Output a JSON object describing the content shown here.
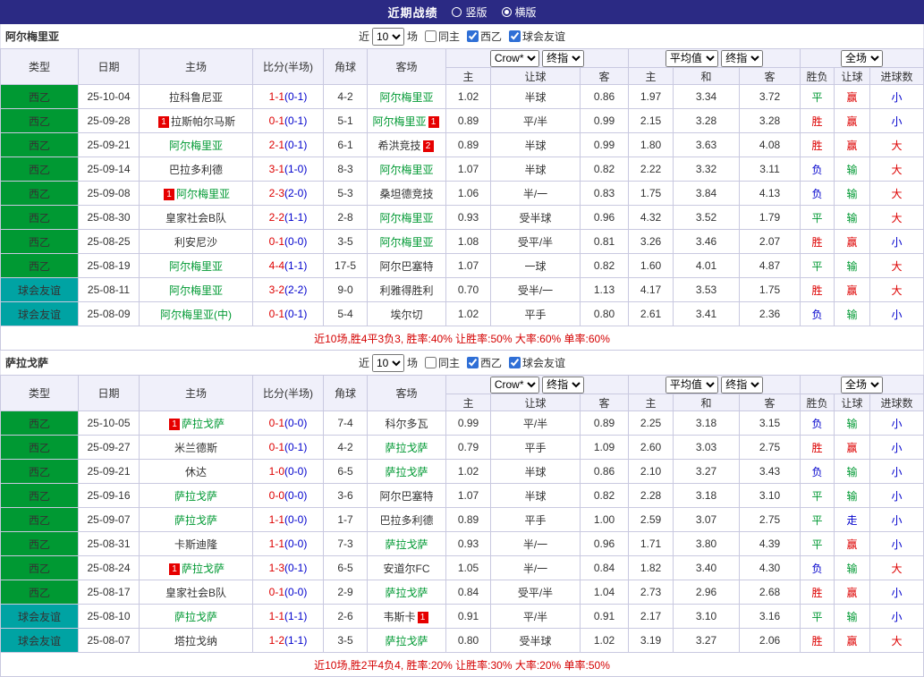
{
  "colors": {
    "red": "#dd0000",
    "green": "#009933",
    "blue": "#0000cc",
    "teal": "#00a3a3",
    "focus_team": "#009933",
    "score": "#dd0000",
    "half": "#0000cc",
    "topbar_bg": "#2b2a84",
    "summary": "#d40000"
  },
  "top_bar": {
    "title": "近期战绩",
    "vertical": "竖版",
    "horizontal": "横版"
  },
  "filter": {
    "near_label": "近",
    "count": "10",
    "games_label": "场",
    "same_home": "同主",
    "league": "西乙",
    "friendly": "球会友谊"
  },
  "table_head": {
    "type": "类型",
    "date": "日期",
    "home": "主场",
    "score": "比分(半场)",
    "corner": "角球",
    "away": "客场",
    "bookmaker": "Crow*",
    "final_odds": "终指",
    "average": "平均值",
    "full_match": "全场",
    "odds_home": "主",
    "odds_handicap": "让球",
    "odds_away": "客",
    "avg_home": "主",
    "avg_draw": "和",
    "avg_away": "客",
    "wdl": "胜负",
    "handicap_result": "让球",
    "goals": "进球数"
  },
  "sections": [
    {
      "team": "阿尔梅里亚",
      "summary": "近10场,胜4平3负3, 胜率:40% 让胜率:50% 大率:60% 单率:60%",
      "rows": [
        {
          "league": "西乙",
          "lc": "green",
          "date": "25-10-04",
          "home": {
            "name": "拉科鲁尼亚",
            "focus": false
          },
          "score": "1-1",
          "half": "(0-1)",
          "corners": "4-2",
          "away": {
            "name": "阿尔梅里亚",
            "focus": true
          },
          "odds": [
            "1.02",
            "半球",
            "0.86"
          ],
          "avg": [
            "1.97",
            "3.34",
            "3.72"
          ],
          "res": [
            [
              "平",
              "green"
            ],
            [
              "赢",
              "red"
            ],
            [
              "小",
              "blue"
            ]
          ]
        },
        {
          "league": "西乙",
          "lc": "green",
          "date": "25-09-28",
          "home": {
            "name": "拉斯帕尔马斯",
            "focus": false,
            "card": {
              "n": "1",
              "pos": "before"
            }
          },
          "score": "0-1",
          "half": "(0-1)",
          "corners": "5-1",
          "away": {
            "name": "阿尔梅里亚",
            "focus": true,
            "card": {
              "n": "1",
              "pos": "after"
            }
          },
          "odds": [
            "0.89",
            "平/半",
            "0.99"
          ],
          "avg": [
            "2.15",
            "3.28",
            "3.28"
          ],
          "res": [
            [
              "胜",
              "red"
            ],
            [
              "赢",
              "red"
            ],
            [
              "小",
              "blue"
            ]
          ]
        },
        {
          "league": "西乙",
          "lc": "green",
          "date": "25-09-21",
          "home": {
            "name": "阿尔梅里亚",
            "focus": true
          },
          "score": "2-1",
          "half": "(0-1)",
          "corners": "6-1",
          "away": {
            "name": "希洪竞技",
            "focus": false,
            "card": {
              "n": "2",
              "pos": "after"
            }
          },
          "odds": [
            "0.89",
            "半球",
            "0.99"
          ],
          "avg": [
            "1.80",
            "3.63",
            "4.08"
          ],
          "res": [
            [
              "胜",
              "red"
            ],
            [
              "赢",
              "red"
            ],
            [
              "大",
              "red"
            ]
          ]
        },
        {
          "league": "西乙",
          "lc": "green",
          "date": "25-09-14",
          "home": {
            "name": "巴拉多利德",
            "focus": false
          },
          "score": "3-1",
          "half": "(1-0)",
          "corners": "8-3",
          "away": {
            "name": "阿尔梅里亚",
            "focus": true
          },
          "odds": [
            "1.07",
            "半球",
            "0.82"
          ],
          "avg": [
            "2.22",
            "3.32",
            "3.11"
          ],
          "res": [
            [
              "负",
              "blue"
            ],
            [
              "输",
              "green"
            ],
            [
              "大",
              "red"
            ]
          ]
        },
        {
          "league": "西乙",
          "lc": "green",
          "date": "25-09-08",
          "home": {
            "name": "阿尔梅里亚",
            "focus": true,
            "card": {
              "n": "1",
              "pos": "before"
            }
          },
          "score": "2-3",
          "half": "(2-0)",
          "corners": "5-3",
          "away": {
            "name": "桑坦德竞技",
            "focus": false
          },
          "odds": [
            "1.06",
            "半/一",
            "0.83"
          ],
          "avg": [
            "1.75",
            "3.84",
            "4.13"
          ],
          "res": [
            [
              "负",
              "blue"
            ],
            [
              "输",
              "green"
            ],
            [
              "大",
              "red"
            ]
          ]
        },
        {
          "league": "西乙",
          "lc": "green",
          "date": "25-08-30",
          "home": {
            "name": "皇家社会B队",
            "focus": false
          },
          "score": "2-2",
          "half": "(1-1)",
          "corners": "2-8",
          "away": {
            "name": "阿尔梅里亚",
            "focus": true
          },
          "odds": [
            "0.93",
            "受半球",
            "0.96"
          ],
          "avg": [
            "4.32",
            "3.52",
            "1.79"
          ],
          "res": [
            [
              "平",
              "green"
            ],
            [
              "输",
              "green"
            ],
            [
              "大",
              "red"
            ]
          ]
        },
        {
          "league": "西乙",
          "lc": "green",
          "date": "25-08-25",
          "home": {
            "name": "利安尼沙",
            "focus": false
          },
          "score": "0-1",
          "half": "(0-0)",
          "corners": "3-5",
          "away": {
            "name": "阿尔梅里亚",
            "focus": true
          },
          "odds": [
            "1.08",
            "受平/半",
            "0.81"
          ],
          "avg": [
            "3.26",
            "3.46",
            "2.07"
          ],
          "res": [
            [
              "胜",
              "red"
            ],
            [
              "赢",
              "red"
            ],
            [
              "小",
              "blue"
            ]
          ]
        },
        {
          "league": "西乙",
          "lc": "green",
          "date": "25-08-19",
          "home": {
            "name": "阿尔梅里亚",
            "focus": true
          },
          "score": "4-4",
          "half": "(1-1)",
          "corners": "17-5",
          "away": {
            "name": "阿尔巴塞特",
            "focus": false
          },
          "odds": [
            "1.07",
            "一球",
            "0.82"
          ],
          "avg": [
            "1.60",
            "4.01",
            "4.87"
          ],
          "res": [
            [
              "平",
              "green"
            ],
            [
              "输",
              "green"
            ],
            [
              "大",
              "red"
            ]
          ]
        },
        {
          "league": "球会友谊",
          "lc": "teal",
          "date": "25-08-11",
          "home": {
            "name": "阿尔梅里亚",
            "focus": true
          },
          "score": "3-2",
          "half": "(2-2)",
          "corners": "9-0",
          "away": {
            "name": "利雅得胜利",
            "focus": false
          },
          "odds": [
            "0.70",
            "受半/一",
            "1.13"
          ],
          "avg": [
            "4.17",
            "3.53",
            "1.75"
          ],
          "res": [
            [
              "胜",
              "red"
            ],
            [
              "赢",
              "red"
            ],
            [
              "大",
              "red"
            ]
          ]
        },
        {
          "league": "球会友谊",
          "lc": "teal",
          "date": "25-08-09",
          "home": {
            "name": "阿尔梅里亚(中)",
            "focus": true
          },
          "score": "0-1",
          "half": "(0-1)",
          "corners": "5-4",
          "away": {
            "name": "埃尔切",
            "focus": false
          },
          "odds": [
            "1.02",
            "平手",
            "0.80"
          ],
          "avg": [
            "2.61",
            "3.41",
            "2.36"
          ],
          "res": [
            [
              "负",
              "blue"
            ],
            [
              "输",
              "green"
            ],
            [
              "小",
              "blue"
            ]
          ]
        }
      ]
    },
    {
      "team": "萨拉戈萨",
      "summary": "近10场,胜2平4负4, 胜率:20% 让胜率:30% 大率:20% 单率:50%",
      "rows": [
        {
          "league": "西乙",
          "lc": "green",
          "date": "25-10-05",
          "home": {
            "name": "萨拉戈萨",
            "focus": true,
            "card": {
              "n": "1",
              "pos": "before"
            }
          },
          "score": "0-1",
          "half": "(0-0)",
          "corners": "7-4",
          "away": {
            "name": "科尔多瓦",
            "focus": false
          },
          "odds": [
            "0.99",
            "平/半",
            "0.89"
          ],
          "avg": [
            "2.25",
            "3.18",
            "3.15"
          ],
          "res": [
            [
              "负",
              "blue"
            ],
            [
              "输",
              "green"
            ],
            [
              "小",
              "blue"
            ]
          ]
        },
        {
          "league": "西乙",
          "lc": "green",
          "date": "25-09-27",
          "home": {
            "name": "米兰德斯",
            "focus": false
          },
          "score": "0-1",
          "half": "(0-1)",
          "corners": "4-2",
          "away": {
            "name": "萨拉戈萨",
            "focus": true
          },
          "odds": [
            "0.79",
            "平手",
            "1.09"
          ],
          "avg": [
            "2.60",
            "3.03",
            "2.75"
          ],
          "res": [
            [
              "胜",
              "red"
            ],
            [
              "赢",
              "red"
            ],
            [
              "小",
              "blue"
            ]
          ]
        },
        {
          "league": "西乙",
          "lc": "green",
          "date": "25-09-21",
          "home": {
            "name": "休达",
            "focus": false
          },
          "score": "1-0",
          "half": "(0-0)",
          "corners": "6-5",
          "away": {
            "name": "萨拉戈萨",
            "focus": true
          },
          "odds": [
            "1.02",
            "半球",
            "0.86"
          ],
          "avg": [
            "2.10",
            "3.27",
            "3.43"
          ],
          "res": [
            [
              "负",
              "blue"
            ],
            [
              "输",
              "green"
            ],
            [
              "小",
              "blue"
            ]
          ]
        },
        {
          "league": "西乙",
          "lc": "green",
          "date": "25-09-16",
          "home": {
            "name": "萨拉戈萨",
            "focus": true
          },
          "score": "0-0",
          "half": "(0-0)",
          "corners": "3-6",
          "away": {
            "name": "阿尔巴塞特",
            "focus": false
          },
          "odds": [
            "1.07",
            "半球",
            "0.82"
          ],
          "avg": [
            "2.28",
            "3.18",
            "3.10"
          ],
          "res": [
            [
              "平",
              "green"
            ],
            [
              "输",
              "green"
            ],
            [
              "小",
              "blue"
            ]
          ]
        },
        {
          "league": "西乙",
          "lc": "green",
          "date": "25-09-07",
          "home": {
            "name": "萨拉戈萨",
            "focus": true
          },
          "score": "1-1",
          "half": "(0-0)",
          "corners": "1-7",
          "away": {
            "name": "巴拉多利德",
            "focus": false
          },
          "odds": [
            "0.89",
            "平手",
            "1.00"
          ],
          "avg": [
            "2.59",
            "3.07",
            "2.75"
          ],
          "res": [
            [
              "平",
              "green"
            ],
            [
              "走",
              "blue"
            ],
            [
              "小",
              "blue"
            ]
          ]
        },
        {
          "league": "西乙",
          "lc": "green",
          "date": "25-08-31",
          "home": {
            "name": "卡斯迪隆",
            "focus": false
          },
          "score": "1-1",
          "half": "(0-0)",
          "corners": "7-3",
          "away": {
            "name": "萨拉戈萨",
            "focus": true
          },
          "odds": [
            "0.93",
            "半/一",
            "0.96"
          ],
          "avg": [
            "1.71",
            "3.80",
            "4.39"
          ],
          "res": [
            [
              "平",
              "green"
            ],
            [
              "赢",
              "red"
            ],
            [
              "小",
              "blue"
            ]
          ]
        },
        {
          "league": "西乙",
          "lc": "green",
          "date": "25-08-24",
          "home": {
            "name": "萨拉戈萨",
            "focus": true,
            "card": {
              "n": "1",
              "pos": "before"
            }
          },
          "score": "1-3",
          "half": "(0-1)",
          "corners": "6-5",
          "away": {
            "name": "安道尔FC",
            "focus": false
          },
          "odds": [
            "1.05",
            "半/一",
            "0.84"
          ],
          "avg": [
            "1.82",
            "3.40",
            "4.30"
          ],
          "res": [
            [
              "负",
              "blue"
            ],
            [
              "输",
              "green"
            ],
            [
              "大",
              "red"
            ]
          ]
        },
        {
          "league": "西乙",
          "lc": "green",
          "date": "25-08-17",
          "home": {
            "name": "皇家社会B队",
            "focus": false
          },
          "score": "0-1",
          "half": "(0-0)",
          "corners": "2-9",
          "away": {
            "name": "萨拉戈萨",
            "focus": true
          },
          "odds": [
            "0.84",
            "受平/半",
            "1.04"
          ],
          "avg": [
            "2.73",
            "2.96",
            "2.68"
          ],
          "res": [
            [
              "胜",
              "red"
            ],
            [
              "赢",
              "red"
            ],
            [
              "小",
              "blue"
            ]
          ]
        },
        {
          "league": "球会友谊",
          "lc": "teal",
          "date": "25-08-10",
          "home": {
            "name": "萨拉戈萨",
            "focus": true
          },
          "score": "1-1",
          "half": "(1-1)",
          "corners": "2-6",
          "away": {
            "name": "韦斯卡",
            "focus": false,
            "card": {
              "n": "1",
              "pos": "after"
            }
          },
          "odds": [
            "0.91",
            "平/半",
            "0.91"
          ],
          "avg": [
            "2.17",
            "3.10",
            "3.16"
          ],
          "res": [
            [
              "平",
              "green"
            ],
            [
              "输",
              "green"
            ],
            [
              "小",
              "blue"
            ]
          ]
        },
        {
          "league": "球会友谊",
          "lc": "teal",
          "date": "25-08-07",
          "home": {
            "name": "塔拉戈纳",
            "focus": false
          },
          "score": "1-2",
          "half": "(1-1)",
          "corners": "3-5",
          "away": {
            "name": "萨拉戈萨",
            "focus": true
          },
          "odds": [
            "0.80",
            "受半球",
            "1.02"
          ],
          "avg": [
            "3.19",
            "3.27",
            "2.06"
          ],
          "res": [
            [
              "胜",
              "red"
            ],
            [
              "赢",
              "red"
            ],
            [
              "大",
              "red"
            ]
          ]
        }
      ]
    }
  ]
}
